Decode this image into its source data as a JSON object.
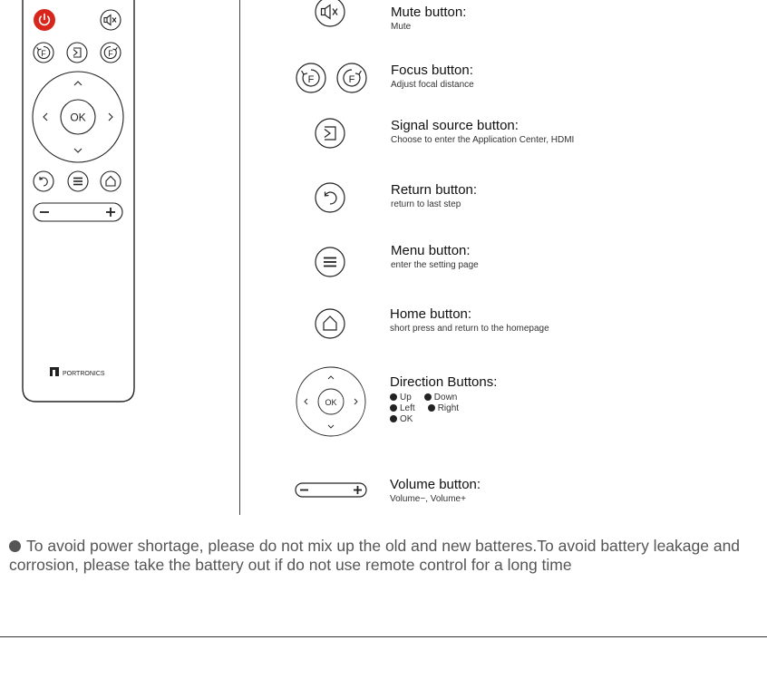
{
  "remote": {
    "ok_label": "OK",
    "brand": "PORTRONICS"
  },
  "buttons": [
    {
      "title": "Mute button:",
      "desc": "Mute"
    },
    {
      "title": "Focus button:",
      "desc": "Adjust focal distance"
    },
    {
      "title": "Signal source button:",
      "desc": "Choose to enter the Application Center, HDMI"
    },
    {
      "title": "Return button:",
      "desc": "return to last step"
    },
    {
      "title": "Menu button:",
      "desc": "enter the setting page"
    },
    {
      "title": "Home button:",
      "desc": "short press and return to the homepage"
    },
    {
      "title": "Direction Buttons:",
      "desc": ""
    },
    {
      "title": "Volume button:",
      "desc": "Volume−, Volume+"
    }
  ],
  "direction": {
    "up": "Up",
    "down": "Down",
    "left": "Left",
    "right": "Right",
    "ok": "OK",
    "ok_label": "OK"
  },
  "note": "To avoid power shortage, please do not mix up the old and new batteres.To avoid battery leakage and corrosion, please take the battery out if do not use remote control for a long time",
  "colors": {
    "power": "#d8261d",
    "line": "#222222",
    "text": "#333333"
  }
}
